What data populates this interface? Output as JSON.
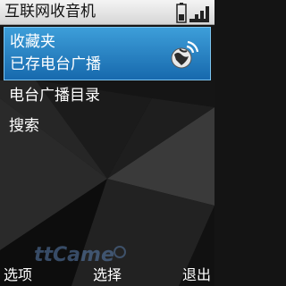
{
  "header": {
    "title": "互联网收音机",
    "status_icons": [
      "battery-icon",
      "signal-strength-icon"
    ]
  },
  "list": {
    "selected_item": {
      "title": "收藏夹",
      "subtitle": "已存电台广播",
      "icon": "globe-wifi-icon"
    },
    "items": [
      {
        "label": "电台广播目录"
      },
      {
        "label": "搜索"
      }
    ]
  },
  "watermark": "ttCamera-like logo",
  "softkeys": {
    "left": "选项",
    "middle": "选择",
    "right": "退出"
  },
  "colors": {
    "selection_top": "#3d9ed9",
    "selection_bottom": "#1769ad",
    "background": "#141414"
  }
}
